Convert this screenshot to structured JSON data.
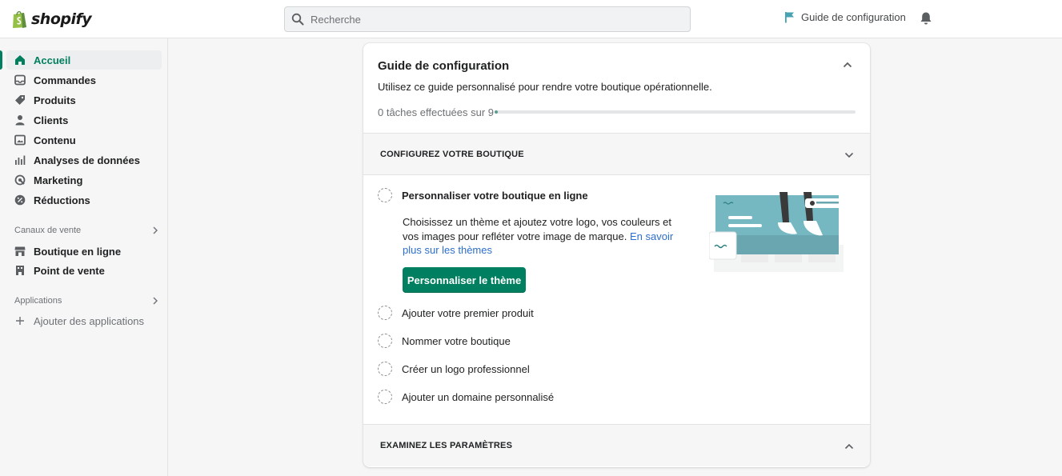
{
  "topbar": {
    "brand": "shopify",
    "search_placeholder": "Recherche",
    "setup_guide_label": "Guide de configuration"
  },
  "sidebar": {
    "items": [
      {
        "label": "Accueil",
        "icon": "home-icon",
        "active": true
      },
      {
        "label": "Commandes",
        "icon": "inbox-icon"
      },
      {
        "label": "Produits",
        "icon": "tag-icon"
      },
      {
        "label": "Clients",
        "icon": "person-icon"
      },
      {
        "label": "Contenu",
        "icon": "image-icon"
      },
      {
        "label": "Analyses de données",
        "icon": "bar-chart-icon"
      },
      {
        "label": "Marketing",
        "icon": "target-icon"
      },
      {
        "label": "Réductions",
        "icon": "discount-icon"
      }
    ],
    "sales_channels_label": "Canaux de vente",
    "sales_channels": [
      {
        "label": "Boutique en ligne",
        "icon": "store-icon"
      },
      {
        "label": "Point de vente",
        "icon": "pos-icon"
      }
    ],
    "apps_label": "Applications",
    "add_apps_label": "Ajouter des applications"
  },
  "guide": {
    "title": "Guide de configuration",
    "subtitle": "Utilisez ce guide personnalisé pour rendre votre boutique opérationnelle.",
    "progress_text": "0 tâches effectuées sur 9",
    "progress_fraction": 0,
    "section1_title": "CONFIGUREZ VOTRE BOUTIQUE",
    "tasks": [
      {
        "label": "Personnaliser votre boutique en ligne",
        "expanded": true
      },
      {
        "label": "Ajouter votre premier produit"
      },
      {
        "label": "Nommer votre boutique"
      },
      {
        "label": "Créer un logo professionnel"
      },
      {
        "label": "Ajouter un domaine personnalisé"
      }
    ],
    "task1_desc": "Choisissez un thème et ajoutez votre logo, vos couleurs et vos images pour refléter votre image de marque. ",
    "task1_link": "En savoir plus sur les thèmes",
    "task1_cta": "Personnaliser le thème",
    "section2_title": "EXAMINEZ LES PARAMÈTRES"
  },
  "colors": {
    "brand_green": "#008060",
    "link_blue": "#2c6ecb",
    "setup_flag": "#47a3b4"
  }
}
